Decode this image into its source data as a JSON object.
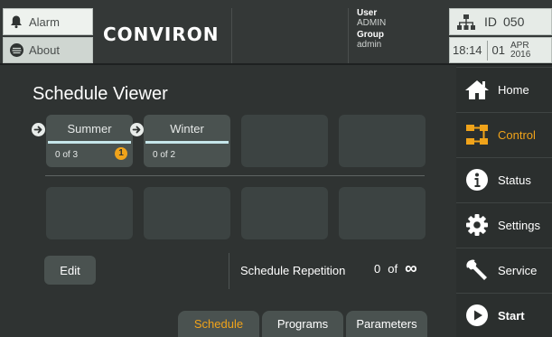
{
  "header": {
    "alarm_label": "Alarm",
    "about_label": "About",
    "logo_text": "CONVIRON",
    "user_label": "User",
    "user_value": "ADMIN",
    "group_label": "Group",
    "group_value": "admin",
    "id_label": "ID",
    "id_value": "050",
    "time": "18:14",
    "day": "01",
    "month": "APR",
    "year": "2016"
  },
  "page": {
    "title": "Schedule Viewer"
  },
  "schedules": [
    {
      "name": "Summer",
      "count": "0 of 3",
      "badge": "1"
    },
    {
      "name": "Winter",
      "count": "0 of 2"
    }
  ],
  "actions": {
    "edit_label": "Edit",
    "repetition_label": "Schedule Repetition",
    "repetition_current": "0",
    "repetition_of": "of",
    "repetition_total": "∞"
  },
  "tabs": [
    "Schedule",
    "Programs",
    "Parameters"
  ],
  "active_tab": "Schedule",
  "sidebar": {
    "items": [
      {
        "label": "Home",
        "icon": "home-icon"
      },
      {
        "label": "Control",
        "icon": "control-icon"
      },
      {
        "label": "Status",
        "icon": "info-icon"
      },
      {
        "label": "Settings",
        "icon": "gear-icon"
      },
      {
        "label": "Service",
        "icon": "wrench-icon"
      },
      {
        "label": "Start",
        "icon": "play-icon"
      }
    ],
    "active": "Control"
  },
  "colors": {
    "accent": "#f0a31a",
    "background": "#2f3332",
    "tile": "#4a5250",
    "progress_line": "#c6e6ea"
  }
}
